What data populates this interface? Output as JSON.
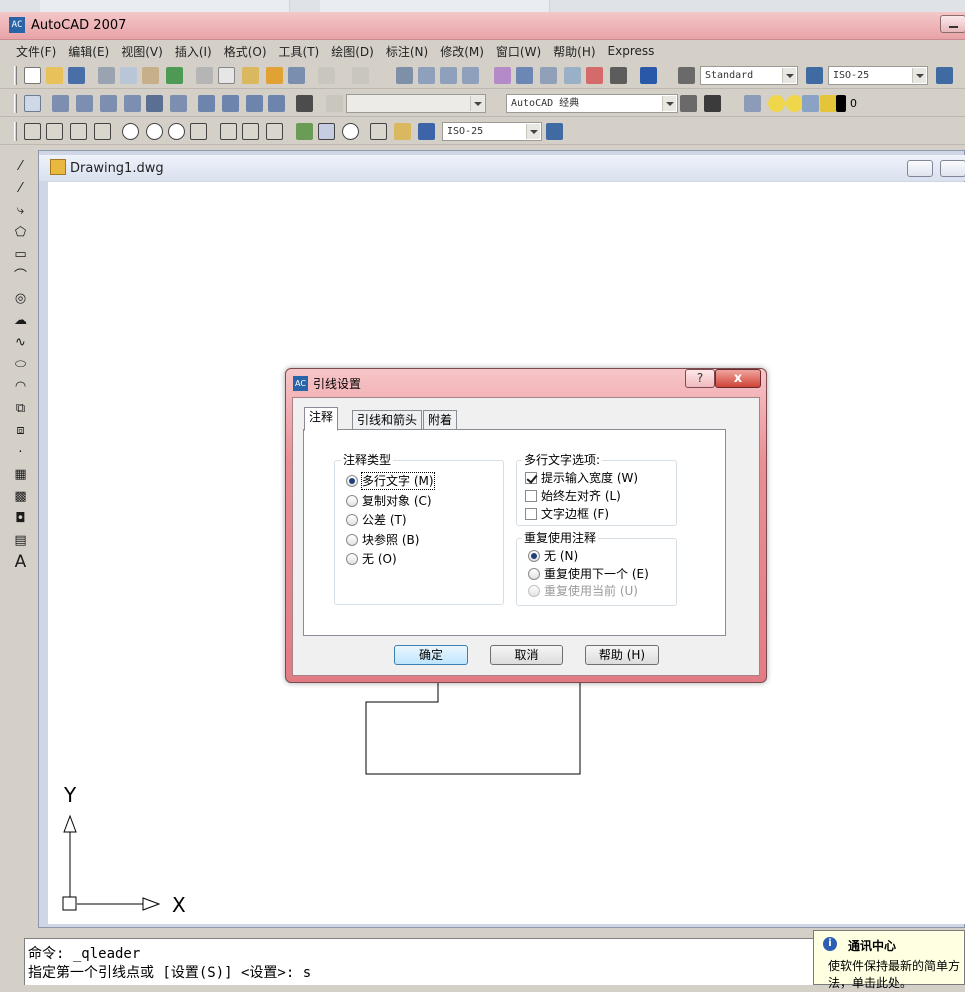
{
  "window": {
    "title": "AutoCAD 2007"
  },
  "menu": [
    "文件(F)",
    "编辑(E)",
    "视图(V)",
    "插入(I)",
    "格式(O)",
    "工具(T)",
    "绘图(D)",
    "标注(N)",
    "修改(M)",
    "窗口(W)",
    "帮助(H)",
    "Express"
  ],
  "toolbars": {
    "text_style": "Standard",
    "dim_style": "ISO-25",
    "workspace": "AutoCAD 经典",
    "layer": "0",
    "dim_style_2": "ISO-25"
  },
  "document": {
    "title": "Drawing1.dwg"
  },
  "axes": {
    "y": "Y",
    "x": "X"
  },
  "command": {
    "line1": "命令: _qleader",
    "line2": "指定第一个引线点或 [设置(S)] <设置>: s"
  },
  "notification": {
    "title": "通讯中心",
    "body": "使软件保持最新的简单方法，单击此处。"
  },
  "dialog": {
    "title": "引线设置",
    "help_label": "?",
    "close_label": "x",
    "tabs": [
      "注释",
      "引线和箭头",
      "附着"
    ],
    "annotation_type": {
      "label": "注释类型",
      "options": [
        "多行文字 (M)",
        "复制对象 (C)",
        "公差 (T)",
        "块参照 (B)",
        "无 (O)"
      ],
      "selected": "多行文字 (M)"
    },
    "mtext_options": {
      "label": "多行文字选项:",
      "items": [
        {
          "label": "提示输入宽度 (W)",
          "checked": true
        },
        {
          "label": "始终左对齐 (L)",
          "checked": false
        },
        {
          "label": "文字边框 (F)",
          "checked": false
        }
      ]
    },
    "reuse": {
      "label": "重复使用注释",
      "options": [
        "无 (N)",
        "重复使用下一个 (E)",
        "重复使用当前 (U)"
      ],
      "selected": "无 (N)"
    },
    "buttons": {
      "ok": "确定",
      "cancel": "取消",
      "help": "帮助 (H)"
    }
  }
}
